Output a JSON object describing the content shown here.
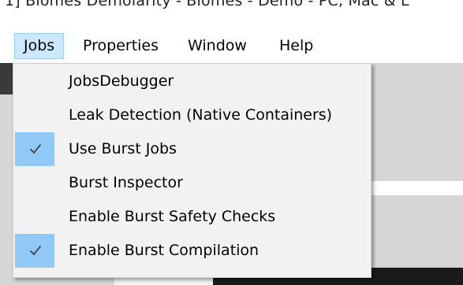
{
  "window": {
    "title": "1]  Biomes Demolarity - Biomes - Demo - PC, Mac & L"
  },
  "menubar": {
    "items": [
      {
        "label": "Jobs"
      },
      {
        "label": "Properties"
      },
      {
        "label": "Window"
      },
      {
        "label": "Help"
      }
    ],
    "active": "Jobs"
  },
  "jobs_menu": {
    "items": [
      {
        "label": "JobsDebugger",
        "checked": false
      },
      {
        "label": "Leak Detection (Native Containers)",
        "checked": false
      },
      {
        "label": "Use Burst Jobs",
        "checked": true
      },
      {
        "label": "Burst Inspector",
        "checked": false
      },
      {
        "label": "Enable Burst Safety Checks",
        "checked": false
      },
      {
        "label": "Enable Burst Compilation",
        "checked": true
      }
    ]
  },
  "icons": {
    "checkmark": "checkmark-icon"
  },
  "colors": {
    "highlight": "#cce8ff",
    "check_bg": "#90c8f6",
    "menu_bg": "#f2f2f2"
  }
}
